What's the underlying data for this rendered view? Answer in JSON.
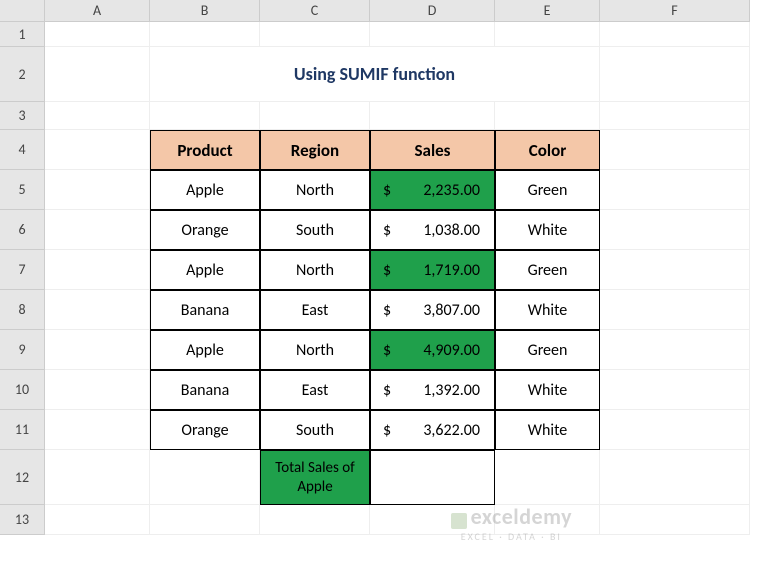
{
  "columns": [
    "A",
    "B",
    "C",
    "D",
    "E",
    "F"
  ],
  "rows": [
    "1",
    "2",
    "3",
    "4",
    "5",
    "6",
    "7",
    "8",
    "9",
    "10",
    "11",
    "12",
    "13"
  ],
  "title": "Using SUMIF function",
  "headers": {
    "product": "Product",
    "region": "Region",
    "sales": "Sales",
    "color": "Color"
  },
  "data": [
    {
      "product": "Apple",
      "region": "North",
      "currency": "$",
      "value": "2,235.00",
      "color": "Green",
      "hl": true
    },
    {
      "product": "Orange",
      "region": "South",
      "currency": "$",
      "value": "1,038.00",
      "color": "White",
      "hl": false
    },
    {
      "product": "Apple",
      "region": "North",
      "currency": "$",
      "value": "1,719.00",
      "color": "Green",
      "hl": true
    },
    {
      "product": "Banana",
      "region": "East",
      "currency": "$",
      "value": "3,807.00",
      "color": "White",
      "hl": false
    },
    {
      "product": "Apple",
      "region": "North",
      "currency": "$",
      "value": "4,909.00",
      "color": "Green",
      "hl": true
    },
    {
      "product": "Banana",
      "region": "East",
      "currency": "$",
      "value": "1,392.00",
      "color": "White",
      "hl": false
    },
    {
      "product": "Orange",
      "region": "South",
      "currency": "$",
      "value": "3,622.00",
      "color": "White",
      "hl": false
    }
  ],
  "total": {
    "label": "Total Sales of Apple",
    "value": ""
  },
  "watermark": {
    "brand": "exceldemy",
    "tag": "EXCEL · DATA · BI"
  },
  "chart_data": {
    "type": "table",
    "title": "Using SUMIF function",
    "columns": [
      "Product",
      "Region",
      "Sales",
      "Color"
    ],
    "rows": [
      [
        "Apple",
        "North",
        2235.0,
        "Green"
      ],
      [
        "Orange",
        "South",
        1038.0,
        "White"
      ],
      [
        "Apple",
        "North",
        1719.0,
        "Green"
      ],
      [
        "Banana",
        "East",
        3807.0,
        "White"
      ],
      [
        "Apple",
        "North",
        4909.0,
        "Green"
      ],
      [
        "Banana",
        "East",
        1392.0,
        "White"
      ],
      [
        "Orange",
        "South",
        3622.0,
        "White"
      ]
    ],
    "summary": {
      "label": "Total Sales of Apple",
      "value": null
    }
  }
}
